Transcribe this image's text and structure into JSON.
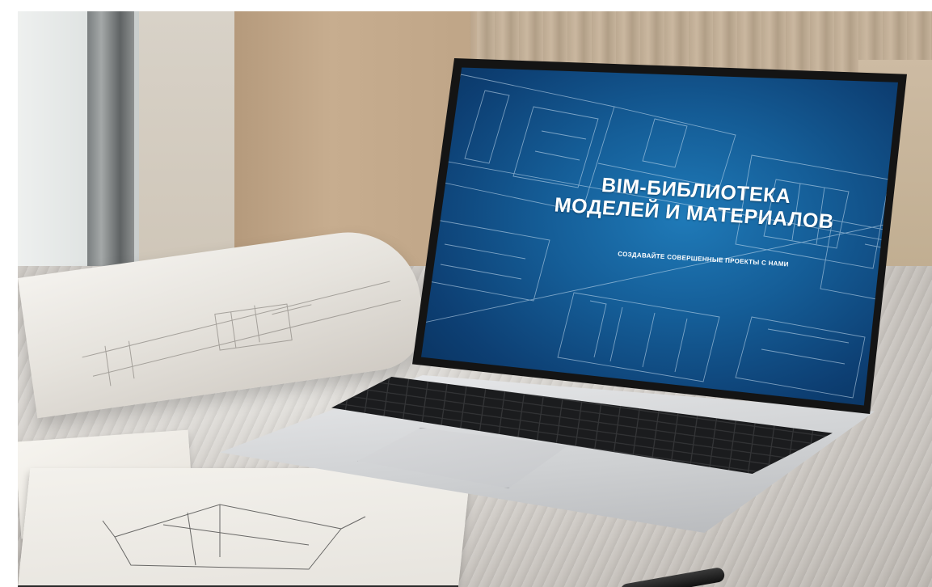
{
  "screen": {
    "title_line1": "BIM-БИБЛИОТЕКА",
    "title_line2": "МОДЕЛЕЙ И МАТЕРИАЛОВ",
    "subtitle": "СОЗДАВАЙТЕ СОВЕРШЕННЫЕ ПРОЕКТЫ С НАМИ"
  },
  "scene_objects": {
    "laptop": "laptop-icon",
    "blueprint_roll": "blueprint-roll-icon",
    "notebook": "notebook-icon",
    "pen": "pen-icon"
  },
  "colors": {
    "screen_blue": "#155e98",
    "screen_dark": "#082c55",
    "line_white": "#cfe4f5"
  }
}
